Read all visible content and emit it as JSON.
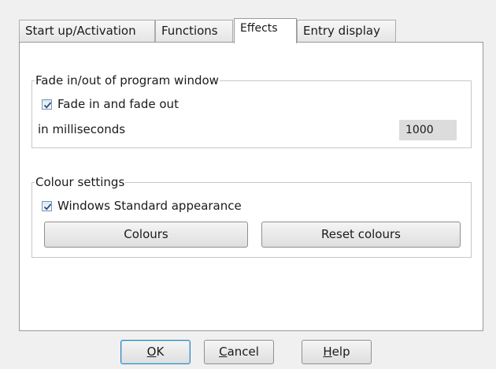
{
  "tabs": [
    {
      "label": "Start up/Activation"
    },
    {
      "label": "Functions"
    },
    {
      "label": "Effects",
      "active": true
    },
    {
      "label": "Entry display"
    }
  ],
  "fade_group": {
    "legend": "Fade in/out of program window",
    "checkbox_label": "Fade in and fade out",
    "checked": true,
    "ms_label": "in milliseconds",
    "ms_value": "1000"
  },
  "colour_group": {
    "legend": "Colour settings",
    "checkbox_label": "Windows Standard appearance",
    "checked": true,
    "colours_button": "Colours",
    "reset_button": "Reset colours"
  },
  "footer": {
    "ok": {
      "mnemonic": "O",
      "rest": "K"
    },
    "cancel": {
      "mnemonic": "C",
      "rest": "ancel"
    },
    "help": {
      "mnemonic": "H",
      "rest": "elp"
    }
  }
}
